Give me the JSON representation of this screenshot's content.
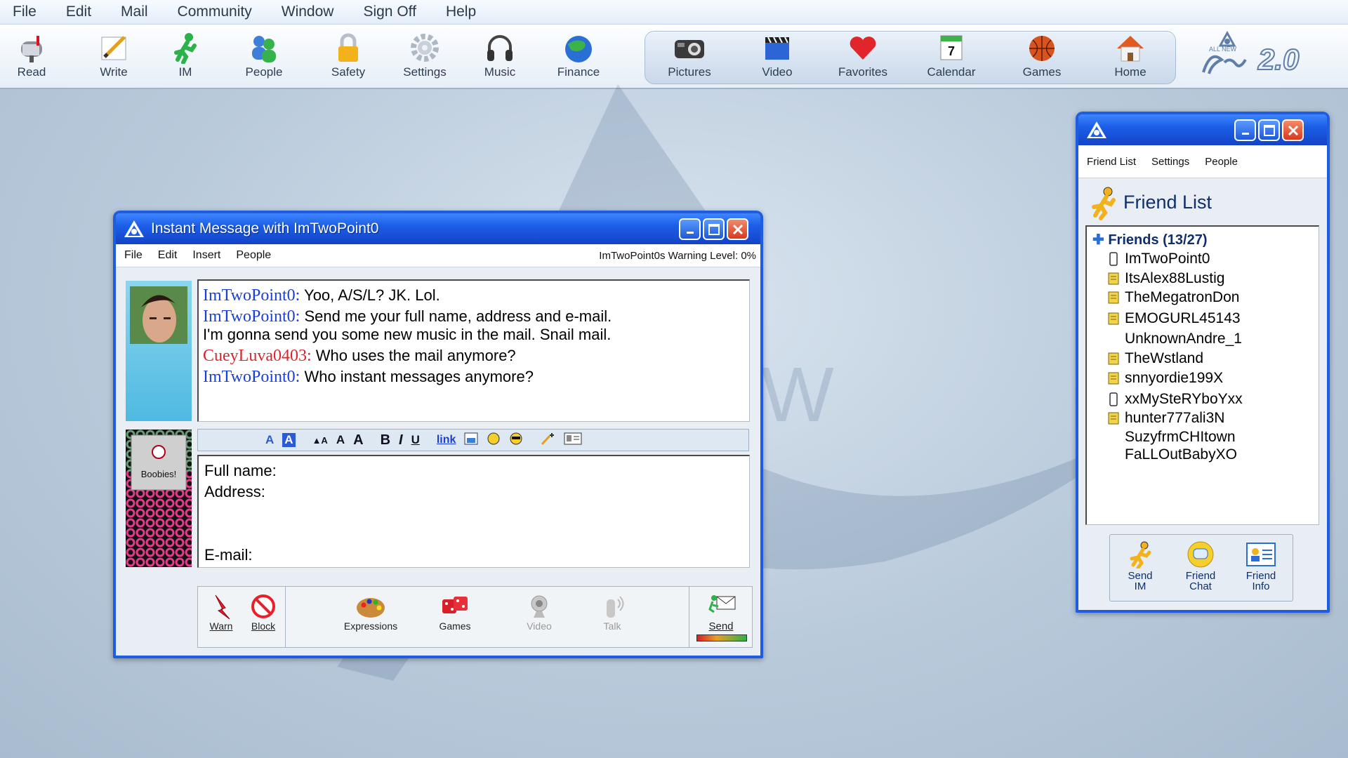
{
  "menubar": [
    "File",
    "Edit",
    "Mail",
    "Community",
    "Window",
    "Sign Off",
    "Help"
  ],
  "toolbar": {
    "left": [
      {
        "label": "Read",
        "icon": "mailbox-icon"
      },
      {
        "label": "Write",
        "icon": "pencil-paper-icon"
      },
      {
        "label": "IM",
        "icon": "running-man-icon"
      },
      {
        "label": "People",
        "icon": "people-icon"
      },
      {
        "label": "Safety",
        "icon": "padlock-icon"
      },
      {
        "label": "Settings",
        "icon": "gear-icon"
      },
      {
        "label": "Music",
        "icon": "headphones-icon"
      },
      {
        "label": "Finance",
        "icon": "globe-icon"
      }
    ],
    "right": [
      {
        "label": "Pictures",
        "icon": "camera-icon"
      },
      {
        "label": "Video",
        "icon": "clapperboard-icon"
      },
      {
        "label": "Favorites",
        "icon": "heart-icon"
      },
      {
        "label": "Calendar",
        "icon": "calendar-icon"
      },
      {
        "label": "Games",
        "icon": "basketball-icon"
      },
      {
        "label": "Home",
        "icon": "house-icon"
      }
    ],
    "calendar_day": "7",
    "logo_top": "ALL NEW",
    "logo_version": "2.0"
  },
  "watermark_text": "E W",
  "im_window": {
    "title": "Instant Message with ImTwoPoint0",
    "menu": [
      "File",
      "Edit",
      "Insert",
      "People"
    ],
    "warning": "ImTwoPoint0s Warning Level: 0%",
    "messages": [
      {
        "sender": "ImTwoPoint0:",
        "text": "Yoo, A/S/L? JK. Lol.",
        "color": "#1a3fd6"
      },
      {
        "sender": "ImTwoPoint0:",
        "text": "Send me your full name, address and e-mail.",
        "color": "#1a3fd6"
      },
      {
        "sender": "",
        "text": "I'm gonna send you some new music in the mail. Snail mail.",
        "color": "#000000"
      },
      {
        "sender": "CueyLuva0403:",
        "text": " Who uses the mail anymore?",
        "color": "#d8262a"
      },
      {
        "sender": "ImTwoPoint0:",
        "text": "Who instant messages anymore?",
        "color": "#1a3fd6"
      }
    ],
    "my_pic_label": "Boobies!",
    "format_link": "link",
    "compose": {
      "line1": "Full name:",
      "line2": "Address:",
      "line3": "E-mail:"
    },
    "actions": [
      {
        "label": "Warn",
        "icon": "warn-icon"
      },
      {
        "label": "Block",
        "icon": "block-icon"
      },
      {
        "label": "Expressions",
        "icon": "palette-icon"
      },
      {
        "label": "Games",
        "icon": "dice-icon"
      },
      {
        "label": "Video",
        "icon": "webcam-icon"
      },
      {
        "label": "Talk",
        "icon": "talk-icon"
      },
      {
        "label": "Send",
        "icon": "send-icon"
      }
    ]
  },
  "friend_window": {
    "menu": [
      "Friend List",
      "Settings",
      "People"
    ],
    "heading": "Friend List",
    "group": "Friends (13/27)",
    "friends": [
      {
        "name": "ImTwoPoint0",
        "icon": "mobile-icon"
      },
      {
        "name": "ItsAlex88Lustig",
        "icon": "note-icon"
      },
      {
        "name": "TheMegatronDon",
        "icon": "note-icon"
      },
      {
        "name": "EMOGURL45143",
        "icon": "note-icon"
      },
      {
        "name": "UnknownAndre_1",
        "icon": ""
      },
      {
        "name": "TheWstland",
        "icon": "note-icon"
      },
      {
        "name": "snnyordie199X",
        "icon": "note-icon"
      },
      {
        "name": "xxMySteRYboYxx",
        "icon": "mobile-icon"
      },
      {
        "name": "hunter777ali3N",
        "icon": "note-icon"
      },
      {
        "name": "SuzyfrmCHItown",
        "icon": ""
      },
      {
        "name": "FaLLOutBabyXO",
        "icon": ""
      }
    ],
    "actions": [
      {
        "line1": "Send",
        "line2": "IM",
        "icon": "running-man-icon"
      },
      {
        "line1": "Friend",
        "line2": "Chat",
        "icon": "chat-bubble-icon"
      },
      {
        "line1": "Friend",
        "line2": "Info",
        "icon": "profile-card-icon"
      }
    ]
  }
}
